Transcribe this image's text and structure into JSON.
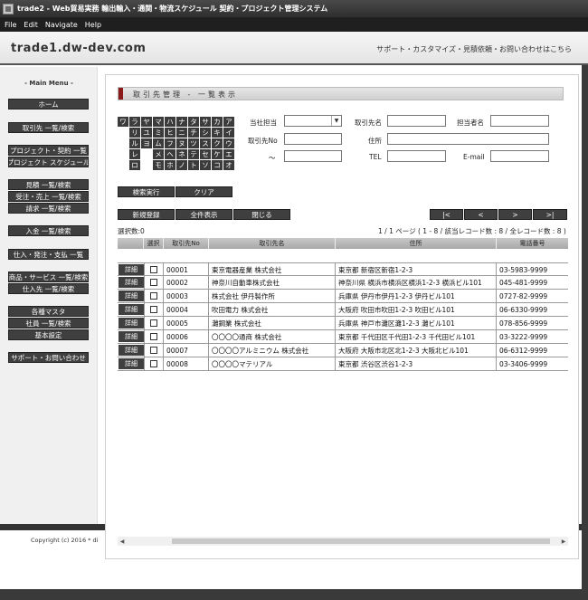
{
  "window": {
    "title": "trade2 - Web貿易実務 輸出輸入・通関・物流スケジュール 契約・プロジェクト管理システム",
    "menu": [
      "File",
      "Edit",
      "Navigate",
      "Help"
    ]
  },
  "header": {
    "site": "trade1.dw-dev.com",
    "links": "サポート・カスタマイズ・見積依頼・お問い合わせはこちら"
  },
  "sidebar": {
    "title": "- Main Menu -",
    "items": [
      "ホーム",
      "取引先 一覧/検索",
      "プロジェクト・契約 一覧",
      "プロジェクト スケジュール",
      "見積 一覧/検索",
      "受注・売上 一覧/検索",
      "請求 一覧/検索",
      "入金 一覧/検索",
      "仕入・発注・支払 一覧",
      "商品・サービス 一覧/検索",
      "仕入先 一覧/検索",
      "各種マスタ",
      "社員 一覧/検索",
      "基本設定",
      "サポート・お問い合わせ"
    ]
  },
  "footer": {
    "copyright": "Copyright (c) 2016 * di"
  },
  "main": {
    "section_title": "取引先管理 - 一覧表示",
    "kana_rows": [
      [
        "ワ",
        "ラ",
        "ヤ",
        "マ",
        "ハ",
        "ナ",
        "タ",
        "サ",
        "カ",
        "ア"
      ],
      [
        "",
        "リ",
        "ユ",
        "ミ",
        "ヒ",
        "ニ",
        "チ",
        "シ",
        "キ",
        "イ"
      ],
      [
        "",
        "ル",
        "ヨ",
        "ム",
        "フ",
        "ヌ",
        "ツ",
        "ス",
        "ク",
        "ウ"
      ],
      [
        "",
        "レ",
        "",
        "メ",
        "ヘ",
        "ネ",
        "テ",
        "セ",
        "ケ",
        "エ"
      ],
      [
        "",
        "ロ",
        "",
        "モ",
        "ホ",
        "ノ",
        "ト",
        "ソ",
        "コ",
        "オ"
      ]
    ],
    "form": {
      "tantou_label": "当社担当",
      "tantou_value": "",
      "name_label": "取引先名",
      "name_value": "",
      "contact_label": "担当者名",
      "contact_value": "",
      "no_label": "取引先No",
      "no_value": "",
      "address_label": "住所",
      "address_value": "",
      "tilde": "～",
      "no_to_value": "",
      "tel_label": "TEL",
      "tel_value": "",
      "email_label": "E-mail",
      "email_value": ""
    },
    "buttons": {
      "search": "検索実行",
      "clear": "クリア",
      "new": "新規登録",
      "show_all": "全件表示",
      "close": "閉じる",
      "first": "|<",
      "prev": "<",
      "next": ">",
      "last": ">|"
    },
    "selected_count": "選択数:0",
    "page_info": "1 / 1 ページ ( 1 - 8 / 該当レコード数 : 8 / 全レコード数 : 8 )",
    "table": {
      "headers": [
        "",
        "選択",
        "取引先No",
        "取引先名",
        "住所",
        "電話番号"
      ],
      "detail_label": "詳細",
      "rows": [
        {
          "no": "00001",
          "name": "東京電器産業 株式会社",
          "address": "東京都 新宿区新宿1-2-3",
          "tel": "03-5983-9999"
        },
        {
          "no": "00002",
          "name": "神奈川自動車株式会社",
          "address": "神奈川県 横浜市横浜区横浜1-2-3 横浜ビル101",
          "tel": "045-481-9999"
        },
        {
          "no": "00003",
          "name": "株式会社 伊丹製作所",
          "address": "兵庫県 伊丹市伊丹1-2-3 伊丹ビル101",
          "tel": "0727-82-9999"
        },
        {
          "no": "00004",
          "name": "吹田電力 株式会社",
          "address": "大阪府 吹田市吹田1-2-3 吹田ビル101",
          "tel": "06-6330-9999"
        },
        {
          "no": "00005",
          "name": "灘鋼業 株式会社",
          "address": "兵庫県 神戸市灘区灘1-2-3 灘ビル101",
          "tel": "078-856-9999"
        },
        {
          "no": "00006",
          "name": "〇〇〇〇通商 株式会社",
          "address": "東京都 千代田区千代田1-2-3 千代田ビル101",
          "tel": "03-3222-9999"
        },
        {
          "no": "00007",
          "name": "〇〇〇〇アルミニウム 株式会社",
          "address": "大阪府 大阪市北区北1-2-3 大阪北ビル101",
          "tel": "06-6312-9999"
        },
        {
          "no": "00008",
          "name": "〇〇〇〇マテリアル",
          "address": "東京都 渋谷区渋谷1-2-3",
          "tel": "03-3406-9999"
        }
      ]
    }
  }
}
